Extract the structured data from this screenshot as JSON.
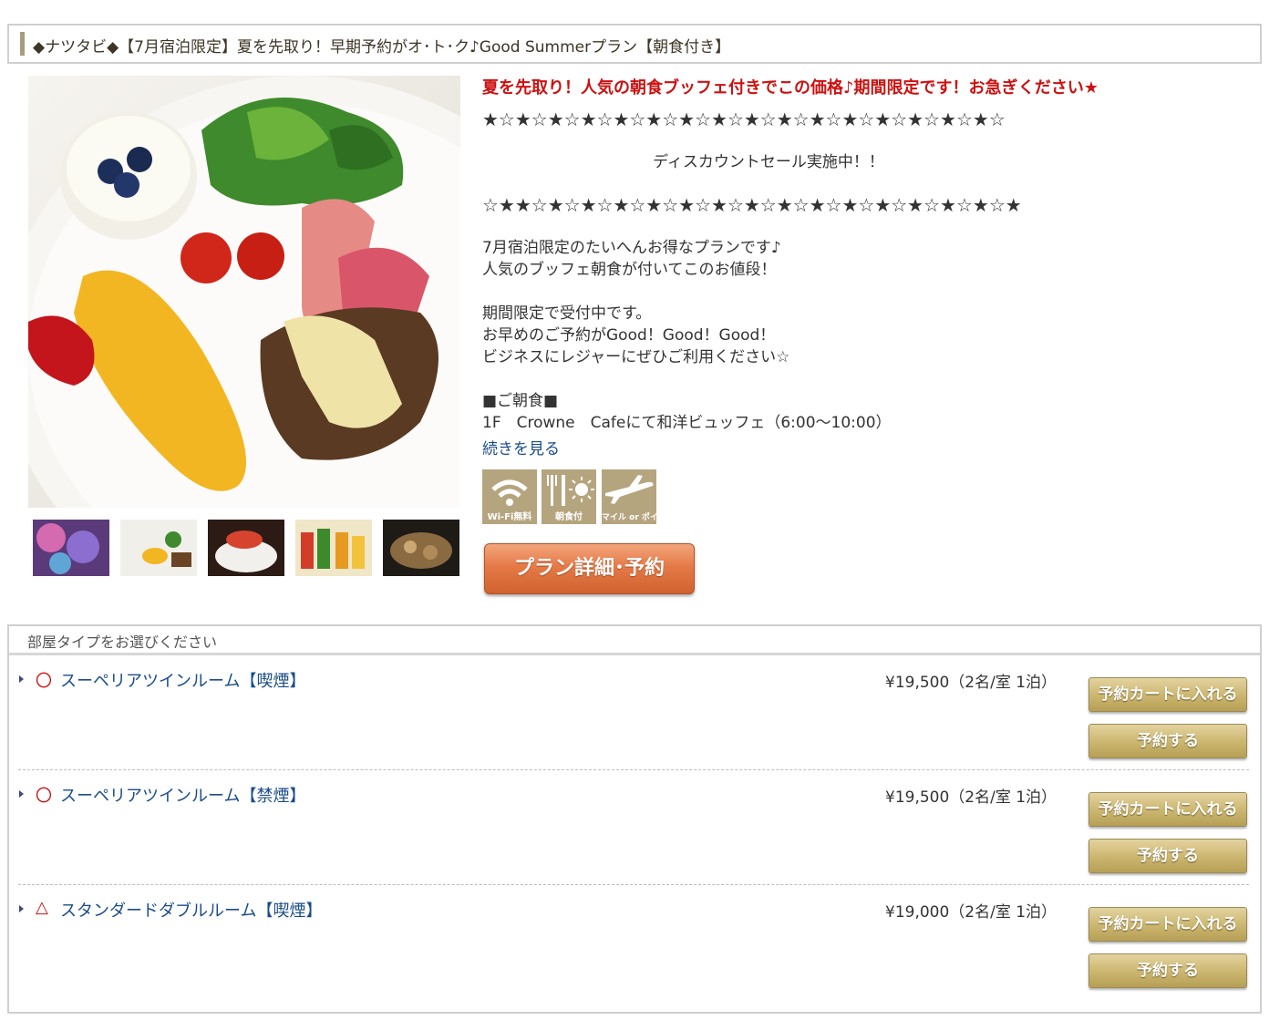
{
  "plan": {
    "title": "◆ナツタビ◆【7月宿泊限定】夏を先取り！早期予約がオ･ト･ク♪Good Summerプラン【朝食付き】",
    "headline": "夏を先取り！人気の朝食ブッフェ付きでこの価格♪期間限定です！お急ぎください★",
    "description": {
      "stars_line1": "★☆★☆★☆★☆★☆★☆★☆★☆★☆★☆★☆★☆★☆★☆★☆★☆",
      "sale_text": "ディスカウントセール実施中！！",
      "stars_line2": "☆★★☆★☆★☆★☆★☆★☆★☆★☆★☆★☆★☆★☆★☆★☆★☆★",
      "line1": "7月宿泊限定のたいへんお得なプランです♪",
      "line2": "人気のブッフェ朝食が付いてこのお値段！",
      "line3": "期間限定で受付中です。",
      "line4": "お早めのご予約がGood！Good！Good！",
      "line5": "ビジネスにレジャーにぜひご利用ください☆",
      "breakfast_heading": "■ご朝食■",
      "breakfast_detail": "1F　Crowne　Cafeにて和洋ビュッフェ（6:00～10:00）"
    },
    "more_link": "続きを見る",
    "amenities": [
      {
        "label": "Wi-Fi無料",
        "icon": "wifi-icon"
      },
      {
        "label": "朝食付",
        "icon": "breakfast-icon"
      },
      {
        "label": "マイル or ポイントOK",
        "icon": "airplane-icon"
      }
    ],
    "detail_button": "プラン詳細･予約"
  },
  "rooms": {
    "heading": "部屋タイプをお選びください",
    "items": [
      {
        "availability": "〇",
        "name": "スーペリアツインルーム【喫煙】",
        "price": "¥19,500（2名/室 1泊）",
        "cart_label": "予約カートに入れる",
        "book_label": "予約する"
      },
      {
        "availability": "〇",
        "name": "スーペリアツインルーム【禁煙】",
        "price": "¥19,500（2名/室 1泊）",
        "cart_label": "予約カートに入れる",
        "book_label": "予約する"
      },
      {
        "availability": "△",
        "name": "スタンダードダブルルーム【喫煙】",
        "price": "¥19,000（2名/室 1泊）",
        "cart_label": "予約カートに入れる",
        "book_label": "予約する"
      }
    ]
  },
  "colors": {
    "headline_red": "#cc1111",
    "link_blue": "#1a4c8a",
    "gold_button": "#cdb872",
    "orange_button": "#e57a47",
    "amenity_tan": "#b5a57f"
  }
}
